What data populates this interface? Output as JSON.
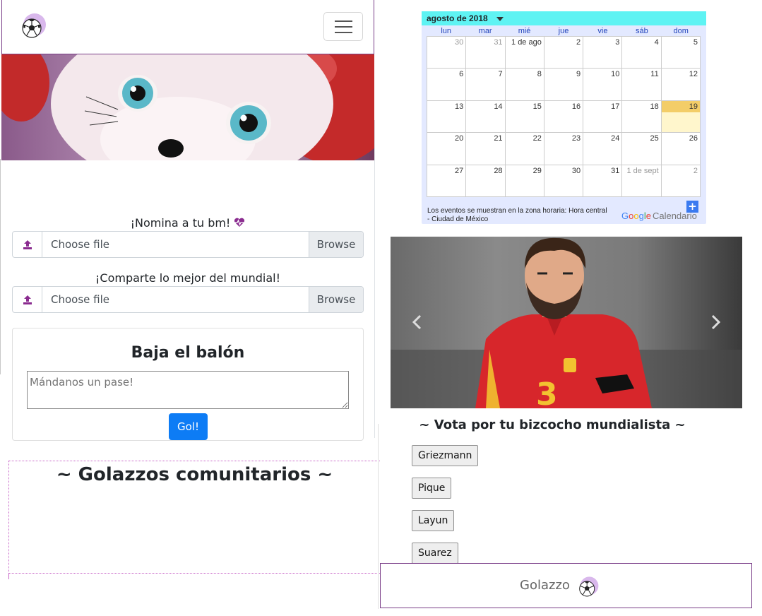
{
  "navbar": {
    "logo_icon": "soccer-ball-logo-icon",
    "toggler_icon": "hamburger-menu-icon"
  },
  "upload1": {
    "label": "¡Nomina a tu bm!",
    "label_icon": "heart-pulse-icon",
    "icon": "upload-icon",
    "file_text": "Choose file",
    "browse_label": "Browse"
  },
  "upload2": {
    "label": "¡Comparte lo mejor del mundial!",
    "icon": "upload-icon",
    "file_text": "Choose file",
    "browse_label": "Browse"
  },
  "comment_card": {
    "title": "Baja el balón",
    "placeholder": "Mándanos un pase!",
    "submit_label": "Gol!"
  },
  "community": {
    "title": "~ Golazzos comunitarios ~"
  },
  "calendar": {
    "month_label": "agosto de 2018",
    "weekdays": [
      "lun",
      "mar",
      "mié",
      "jue",
      "vie",
      "sáb",
      "dom"
    ],
    "weeks": [
      [
        "30",
        "31",
        "1 de ago",
        "2",
        "3",
        "4",
        "5"
      ],
      [
        "6",
        "7",
        "8",
        "9",
        "10",
        "11",
        "12"
      ],
      [
        "13",
        "14",
        "15",
        "16",
        "17",
        "18",
        "19"
      ],
      [
        "20",
        "21",
        "22",
        "23",
        "24",
        "25",
        "26"
      ],
      [
        "27",
        "28",
        "29",
        "30",
        "31",
        "1 de sept",
        "2"
      ]
    ],
    "today": "19",
    "timezone_note": "Los eventos se muestran en la zona horaria: Hora central - Ciudad de México",
    "brand": {
      "google": "Google",
      "product": "Calendario"
    },
    "add_label": "+"
  },
  "carousel": {
    "prev_icon": "chevron-left-icon",
    "next_icon": "chevron-right-icon",
    "jersey_number": "3"
  },
  "vote": {
    "title": "~ Vota por tu bizcocho mundialista ~",
    "options": [
      "Griezmann",
      "Pique",
      "Layun",
      "Suarez"
    ]
  },
  "footer": {
    "text": "Golazzo",
    "logo_icon": "soccer-ball-logo-icon"
  },
  "colors": {
    "accent_purple": "#7a3e88",
    "primary_blue": "#0d7cf5",
    "calendar_header": "#5ef3f3",
    "today_highlight": "#f3cd68",
    "dotted_border": "#c763c7"
  }
}
